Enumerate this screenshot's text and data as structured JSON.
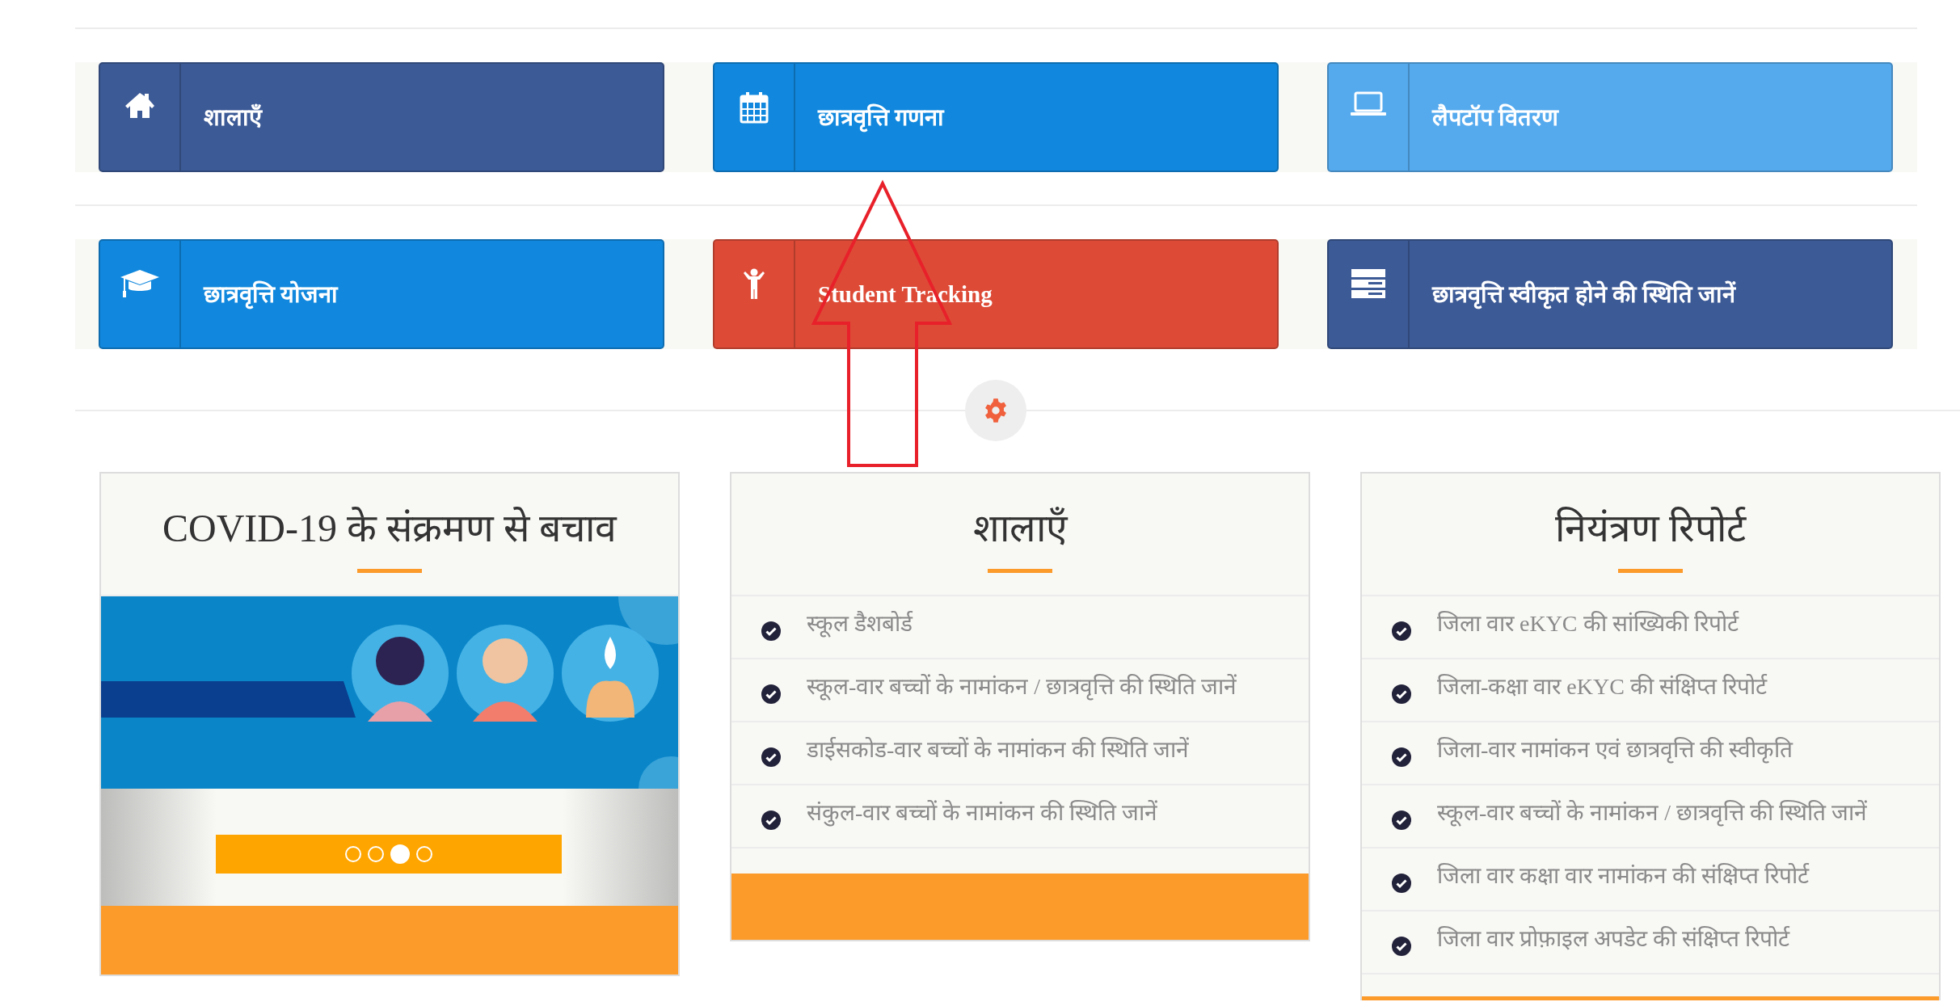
{
  "tile_rows": [
    {
      "tiles": [
        {
          "label": "शालाएँ",
          "color": "#3c5a96"
        },
        {
          "label": "छात्रवृत्ति गणना",
          "color": "#1188dd"
        },
        {
          "label": "लैपटॉप वितरण",
          "color": "#55aaee"
        }
      ]
    },
    {
      "tiles": [
        {
          "label": "छात्रवृत्ति योजना",
          "color": "#1188dd"
        },
        {
          "label": "Student Tracking",
          "color": "#dd4b37"
        },
        {
          "label": "छात्रवृत्ति स्वीकृत होने की स्थिति जानें",
          "color": "#3c5a96"
        }
      ]
    }
  ],
  "cards": [
    {
      "kind": "carousel",
      "title": "COVID-19 के संक्रमण से बचाव",
      "dots": [
        {
          "selected": false
        },
        {
          "selected": false
        },
        {
          "selected": true
        },
        {
          "selected": false
        }
      ]
    },
    {
      "kind": "list",
      "title": "शालाएँ",
      "items": [
        "स्कूल डैशबोर्ड",
        "स्कूल-वार बच्चों के नामांकन / छात्रवृत्ति की स्थिति जानें",
        "डाईसकोड-वार बच्चों के नामांकन की स्थिति जानें",
        "संकुल-वार बच्चों के नामांकन की स्थिति जानें"
      ]
    },
    {
      "kind": "list",
      "title": "नियंत्रण रिपोर्ट",
      "items": [
        "जिला वार eKYC की सांख्यिकी रिपोर्ट",
        "जिला-कक्षा वार eKYC की संक्षिप्त रिपोर्ट",
        "जिला-वार नामांकन एवं छात्रवृत्ति की स्वीकृति",
        "स्कूल-वार बच्चों के नामांकन / छात्रवृत्ति की स्थिति जानें",
        "जिला वार कक्षा वार नामांकन की संक्षिप्त रिपोर्ट",
        "जिला वार प्रोफ़ाइल अपडेट की संक्षिप्त रिपोर्ट"
      ]
    }
  ]
}
